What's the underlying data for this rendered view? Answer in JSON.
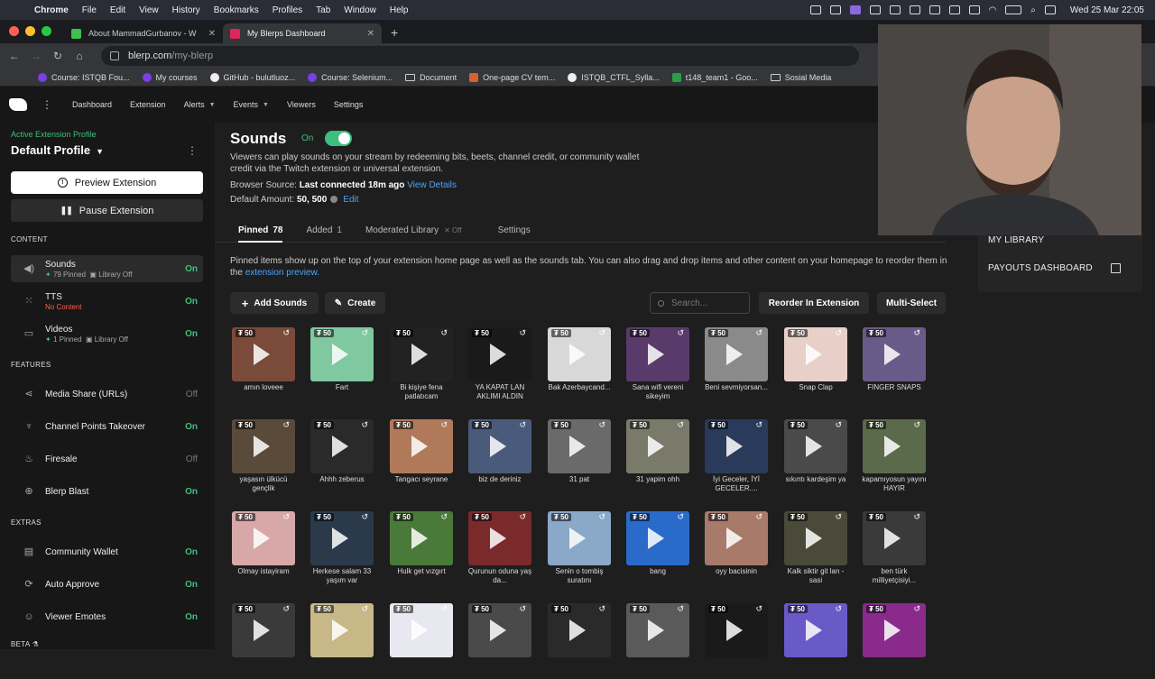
{
  "menubar": {
    "app": "Chrome",
    "items": [
      "File",
      "Edit",
      "View",
      "History",
      "Bookmarks",
      "Profiles",
      "Tab",
      "Window",
      "Help"
    ],
    "clock": "Wed 25 Mar  22:05"
  },
  "browser": {
    "tabs": [
      {
        "title": "About MammadGurbanov - W",
        "favicon_color": "#3fbf4f"
      },
      {
        "title": "My Blerps Dashboard",
        "favicon_color": "#e0245e"
      }
    ],
    "url_host": "blerp.com",
    "url_path": "/my-blerp",
    "bookmarks": [
      {
        "label": "Course: ISTQB Fou...",
        "color": "#7b3fe4"
      },
      {
        "label": "My courses",
        "color": "#7b3fe4"
      },
      {
        "label": "GitHub - bulutluoz...",
        "color": "#eeeeee"
      },
      {
        "label": "Course: Selenium...",
        "color": "#7b3fe4"
      },
      {
        "label": "Document",
        "color": "folder"
      },
      {
        "label": "One-page CV tem...",
        "color": "#d9602a"
      },
      {
        "label": "ISTQB_CTFL_Sylla...",
        "color": "#eeeeee"
      },
      {
        "label": "t148_team1 - Goo...",
        "color": "#2a9d4a"
      },
      {
        "label": "Sosial Media",
        "color": "folder"
      }
    ]
  },
  "appnav": {
    "items": [
      {
        "label": "Dashboard",
        "dropdown": false
      },
      {
        "label": "Extension",
        "dropdown": false
      },
      {
        "label": "Alerts",
        "dropdown": true
      },
      {
        "label": "Events",
        "dropdown": true
      },
      {
        "label": "Viewers",
        "dropdown": false
      },
      {
        "label": "Settings",
        "dropdown": false
      }
    ]
  },
  "sidebar": {
    "active_label": "Active Extension Profile",
    "profile": "Default Profile",
    "preview_btn": "Preview Extension",
    "pause_btn": "Pause Extension",
    "sec_content": "CONTENT",
    "sec_features": "FEATURES",
    "sec_extras": "EXTRAS",
    "sec_beta": "BETA",
    "content": [
      {
        "name": "Sounds",
        "sub1": "79 Pinned",
        "sub2": "Library Off",
        "status": "On"
      },
      {
        "name": "TTS",
        "sub1": "No Content",
        "status": "On"
      },
      {
        "name": "Videos",
        "sub1": "1 Pinned",
        "sub2": "Library Off",
        "status": "On"
      }
    ],
    "features": [
      {
        "name": "Media Share (URLs)",
        "status": "Off"
      },
      {
        "name": "Channel Points Takeover",
        "status": "On"
      },
      {
        "name": "Firesale",
        "status": "Off"
      },
      {
        "name": "Blerp Blast",
        "status": "On"
      }
    ],
    "extras": [
      {
        "name": "Community Wallet",
        "status": "On"
      },
      {
        "name": "Auto Approve",
        "status": "On"
      },
      {
        "name": "Viewer Emotes",
        "status": "On"
      }
    ]
  },
  "main": {
    "title": "Sounds",
    "on_label": "On",
    "description": "Viewers can play sounds on your stream by redeeming bits, beets, channel credit, or community wallet credit via the Twitch extension or universal extension.",
    "browser_source_label": "Browser Source:",
    "browser_source_value": "Last connected 18m ago",
    "view_details": "View Details",
    "default_amount_label": "Default Amount:",
    "default_amount_value": "50, 500",
    "edit": "Edit",
    "tabs": {
      "pinned": "Pinned",
      "pinned_count": "78",
      "added": "Added",
      "added_count": "1",
      "moderated": "Moderated Library",
      "moderated_state": "Off",
      "settings": "Settings"
    },
    "pinned_desc": "Pinned items show up on the top of your extension home page as well as the sounds tab. You can also drag and drop items and other content on your homepage to reorder them in the",
    "pinned_link": "extension preview.",
    "add_sounds": "Add Sounds",
    "create": "Create",
    "search_placeholder": "Search...",
    "reorder": "Reorder In Extension",
    "multiselect": "Multi-Select"
  },
  "right_panel": {
    "my_library": "MY LIBRARY",
    "payouts": "PAYOUTS DASHBOARD"
  },
  "sounds": [
    {
      "price": "50",
      "caption": "amın loveee",
      "color": "#7a4a3a"
    },
    {
      "price": "50",
      "caption": "Fart",
      "color": "#7fc8a0"
    },
    {
      "price": "50",
      "caption": "Bi kişiye fena patlatıcam",
      "color": "#222222"
    },
    {
      "price": "50",
      "caption": "YA KAPAT LAN AKLIMI ALDIN",
      "color": "#1a1a1a"
    },
    {
      "price": "50",
      "caption": "Bak Azerbaycand...",
      "color": "#d8d8d8"
    },
    {
      "price": "50",
      "caption": "Sana wifi vereni sikeyim",
      "color": "#5a3a6a"
    },
    {
      "price": "50",
      "caption": "Beni sevmiyorsan...",
      "color": "#8a8a8a"
    },
    {
      "price": "50",
      "caption": "Snap Clap",
      "color": "#e8d0c8"
    },
    {
      "price": "50",
      "caption": "FINGER SNAPS",
      "color": "#6a5a8a"
    },
    {
      "price": "50",
      "caption": "yaşasın ülkücü gençlik",
      "color": "#5a4a3a"
    },
    {
      "price": "50",
      "caption": "Ahhh zeberus",
      "color": "#2a2a2a"
    },
    {
      "price": "50",
      "caption": "Tangacı seyrane",
      "color": "#b07a5a"
    },
    {
      "price": "50",
      "caption": "biz de deriniz",
      "color": "#4a5a7a"
    },
    {
      "price": "50",
      "caption": "31 pat",
      "color": "#6a6a6a"
    },
    {
      "price": "50",
      "caption": "31 yapim ohh",
      "color": "#7a7a6a"
    },
    {
      "price": "50",
      "caption": "İyi Geceler, İYİ GECELER....",
      "color": "#2a3a5a"
    },
    {
      "price": "50",
      "caption": "sıkıntı kardeşim ya",
      "color": "#4a4a4a"
    },
    {
      "price": "50",
      "caption": "kapamıyosun yayını HAYIR",
      "color": "#5a6a4a"
    },
    {
      "price": "50",
      "caption": "Olmay istayiram",
      "color": "#d8a8a8"
    },
    {
      "price": "50",
      "caption": "Herkese salam 33 yaşım var",
      "color": "#2a3a4a"
    },
    {
      "price": "50",
      "caption": "Hulk get vızgırt",
      "color": "#4a7a3a"
    },
    {
      "price": "50",
      "caption": "Qurunun oduna yaş da...",
      "color": "#7a2a2a"
    },
    {
      "price": "50",
      "caption": "Senin o tombiş suratını",
      "color": "#8aa8c8"
    },
    {
      "price": "50",
      "caption": "bang",
      "color": "#2a6ac8"
    },
    {
      "price": "50",
      "caption": "oyy bacisinin",
      "color": "#a87a6a"
    },
    {
      "price": "50",
      "caption": "Kalk siktir git lan - sasi",
      "color": "#4a4a3a"
    },
    {
      "price": "50",
      "caption": "ben türk milliyetçisiyi...",
      "color": "#3a3a3a"
    },
    {
      "price": "50",
      "caption": "",
      "color": "#3a3a3a"
    },
    {
      "price": "50",
      "caption": "",
      "color": "#c8b888"
    },
    {
      "price": "50",
      "caption": "",
      "color": "#e8e8f0"
    },
    {
      "price": "50",
      "caption": "",
      "color": "#4a4a4a"
    },
    {
      "price": "50",
      "caption": "",
      "color": "#2a2a2a"
    },
    {
      "price": "50",
      "caption": "",
      "color": "#5a5a5a"
    },
    {
      "price": "50",
      "caption": "",
      "color": "#1a1a1a"
    },
    {
      "price": "50",
      "caption": "",
      "color": "#6a5ac8"
    },
    {
      "price": "50",
      "caption": "",
      "color": "#8a2a8a"
    }
  ]
}
